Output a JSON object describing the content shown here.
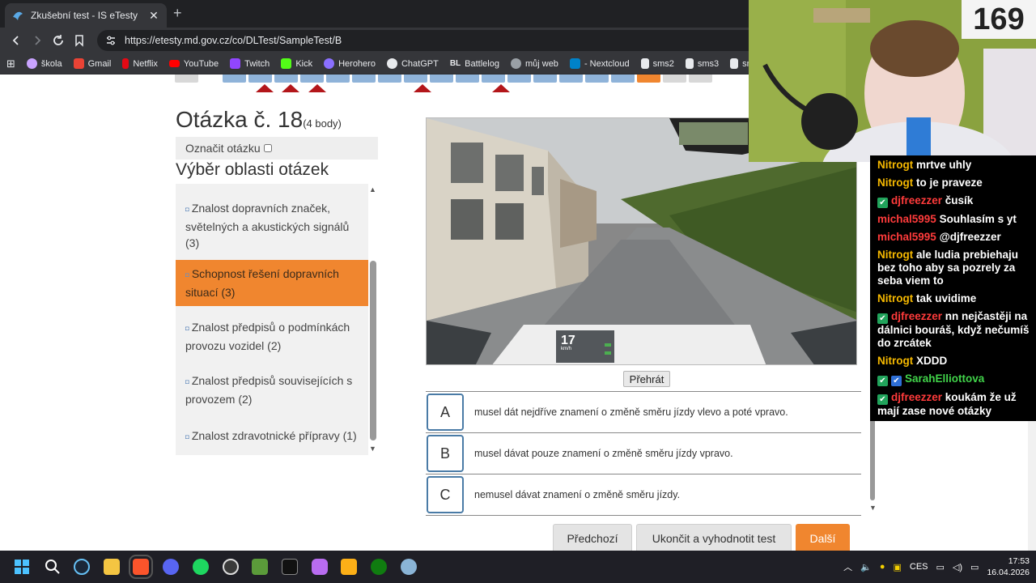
{
  "browser": {
    "tab_title": "Zkušební test - IS eTesty",
    "url": "https://etesty.md.gov.cz/co/DLTest/SampleTest/B",
    "bookmarks": [
      "škola",
      "Gmail",
      "Netflix",
      "YouTube",
      "Twitch",
      "Kick",
      "Herohero",
      "ChatGPT",
      "Battlelog",
      "můj web",
      "- Nextcloud",
      "sms2",
      "sms3",
      "sms1"
    ]
  },
  "question": {
    "title": "Otázka č. 18",
    "points": "(4 body)",
    "flag_label": "Označit otázku"
  },
  "areas": {
    "title": "Výběr oblasti otázek",
    "items": [
      "Znalost dopravních značek, světelných a akustických signálů (3)",
      "Schopnost řešení dopravních situací (3)",
      "Znalost předpisů o podmínkách provozu vozidel (2)",
      "Znalost předpisů souvisejících s provozem (2)",
      "Znalost zdravotnické přípravy (1)"
    ],
    "active_index": 1
  },
  "video": {
    "speed": "17",
    "speed_unit": "km/h",
    "play_label": "Přehrát"
  },
  "answers": [
    {
      "letter": "A",
      "text": "musel dát nejdříve znamení o změně směru jízdy vlevo a poté vpravo."
    },
    {
      "letter": "B",
      "text": "musel dávat pouze znamení o změně směru jízdy vpravo."
    },
    {
      "letter": "C",
      "text": "nemusel dávat znamení o změně směru jízdy."
    }
  ],
  "buttons": {
    "prev": "Předchozí",
    "finish": "Ukončit a vyhodnotit test",
    "next": "Další"
  },
  "stream": {
    "counter": "169",
    "chat": [
      {
        "user": "Nitrogt",
        "color": "#f5b800",
        "badges": [],
        "text": "mrtve uhly"
      },
      {
        "user": "Nitrogt",
        "color": "#f5b800",
        "badges": [],
        "text": "to je praveze"
      },
      {
        "user": "djfreezzer",
        "color": "#ff3b3b",
        "badges": [
          "green"
        ],
        "text": "čusík"
      },
      {
        "user": "michal5995",
        "color": "#ff3b3b",
        "badges": [],
        "text": "Souhlasím s yt"
      },
      {
        "user": "michal5995",
        "color": "#ff3b3b",
        "badges": [],
        "text": "@djfreezzer"
      },
      {
        "user": "Nitrogt",
        "color": "#f5b800",
        "badges": [],
        "text": "ale ludia prebiehaju bez toho aby sa pozrely za seba viem to"
      },
      {
        "user": "Nitrogt",
        "color": "#f5b800",
        "badges": [],
        "text": "tak uvidime"
      },
      {
        "user": "djfreezzer",
        "color": "#ff3b3b",
        "badges": [
          "green"
        ],
        "text": "nn nejčastěji na dálnici bouráš, když nečumíš do zrcátek"
      },
      {
        "user": "Nitrogt",
        "color": "#f5b800",
        "badges": [],
        "text": "XDDD"
      },
      {
        "user": "SarahElliottova",
        "color": "#41d44a",
        "badges": [
          "green",
          "blue"
        ],
        "text": ""
      },
      {
        "user": "djfreezzer",
        "color": "#ff3b3b",
        "badges": [
          "green"
        ],
        "text": "koukám že už mají zase nové otázky"
      }
    ]
  },
  "taskbar": {
    "language": "CES",
    "time": "17:53",
    "date": "16.04.2026"
  },
  "colors": {
    "accent_orange": "#f0862f",
    "nav_blue": "#8fb3d9",
    "flag_red": "#b3161a",
    "answer_border": "#4a7ba6"
  }
}
